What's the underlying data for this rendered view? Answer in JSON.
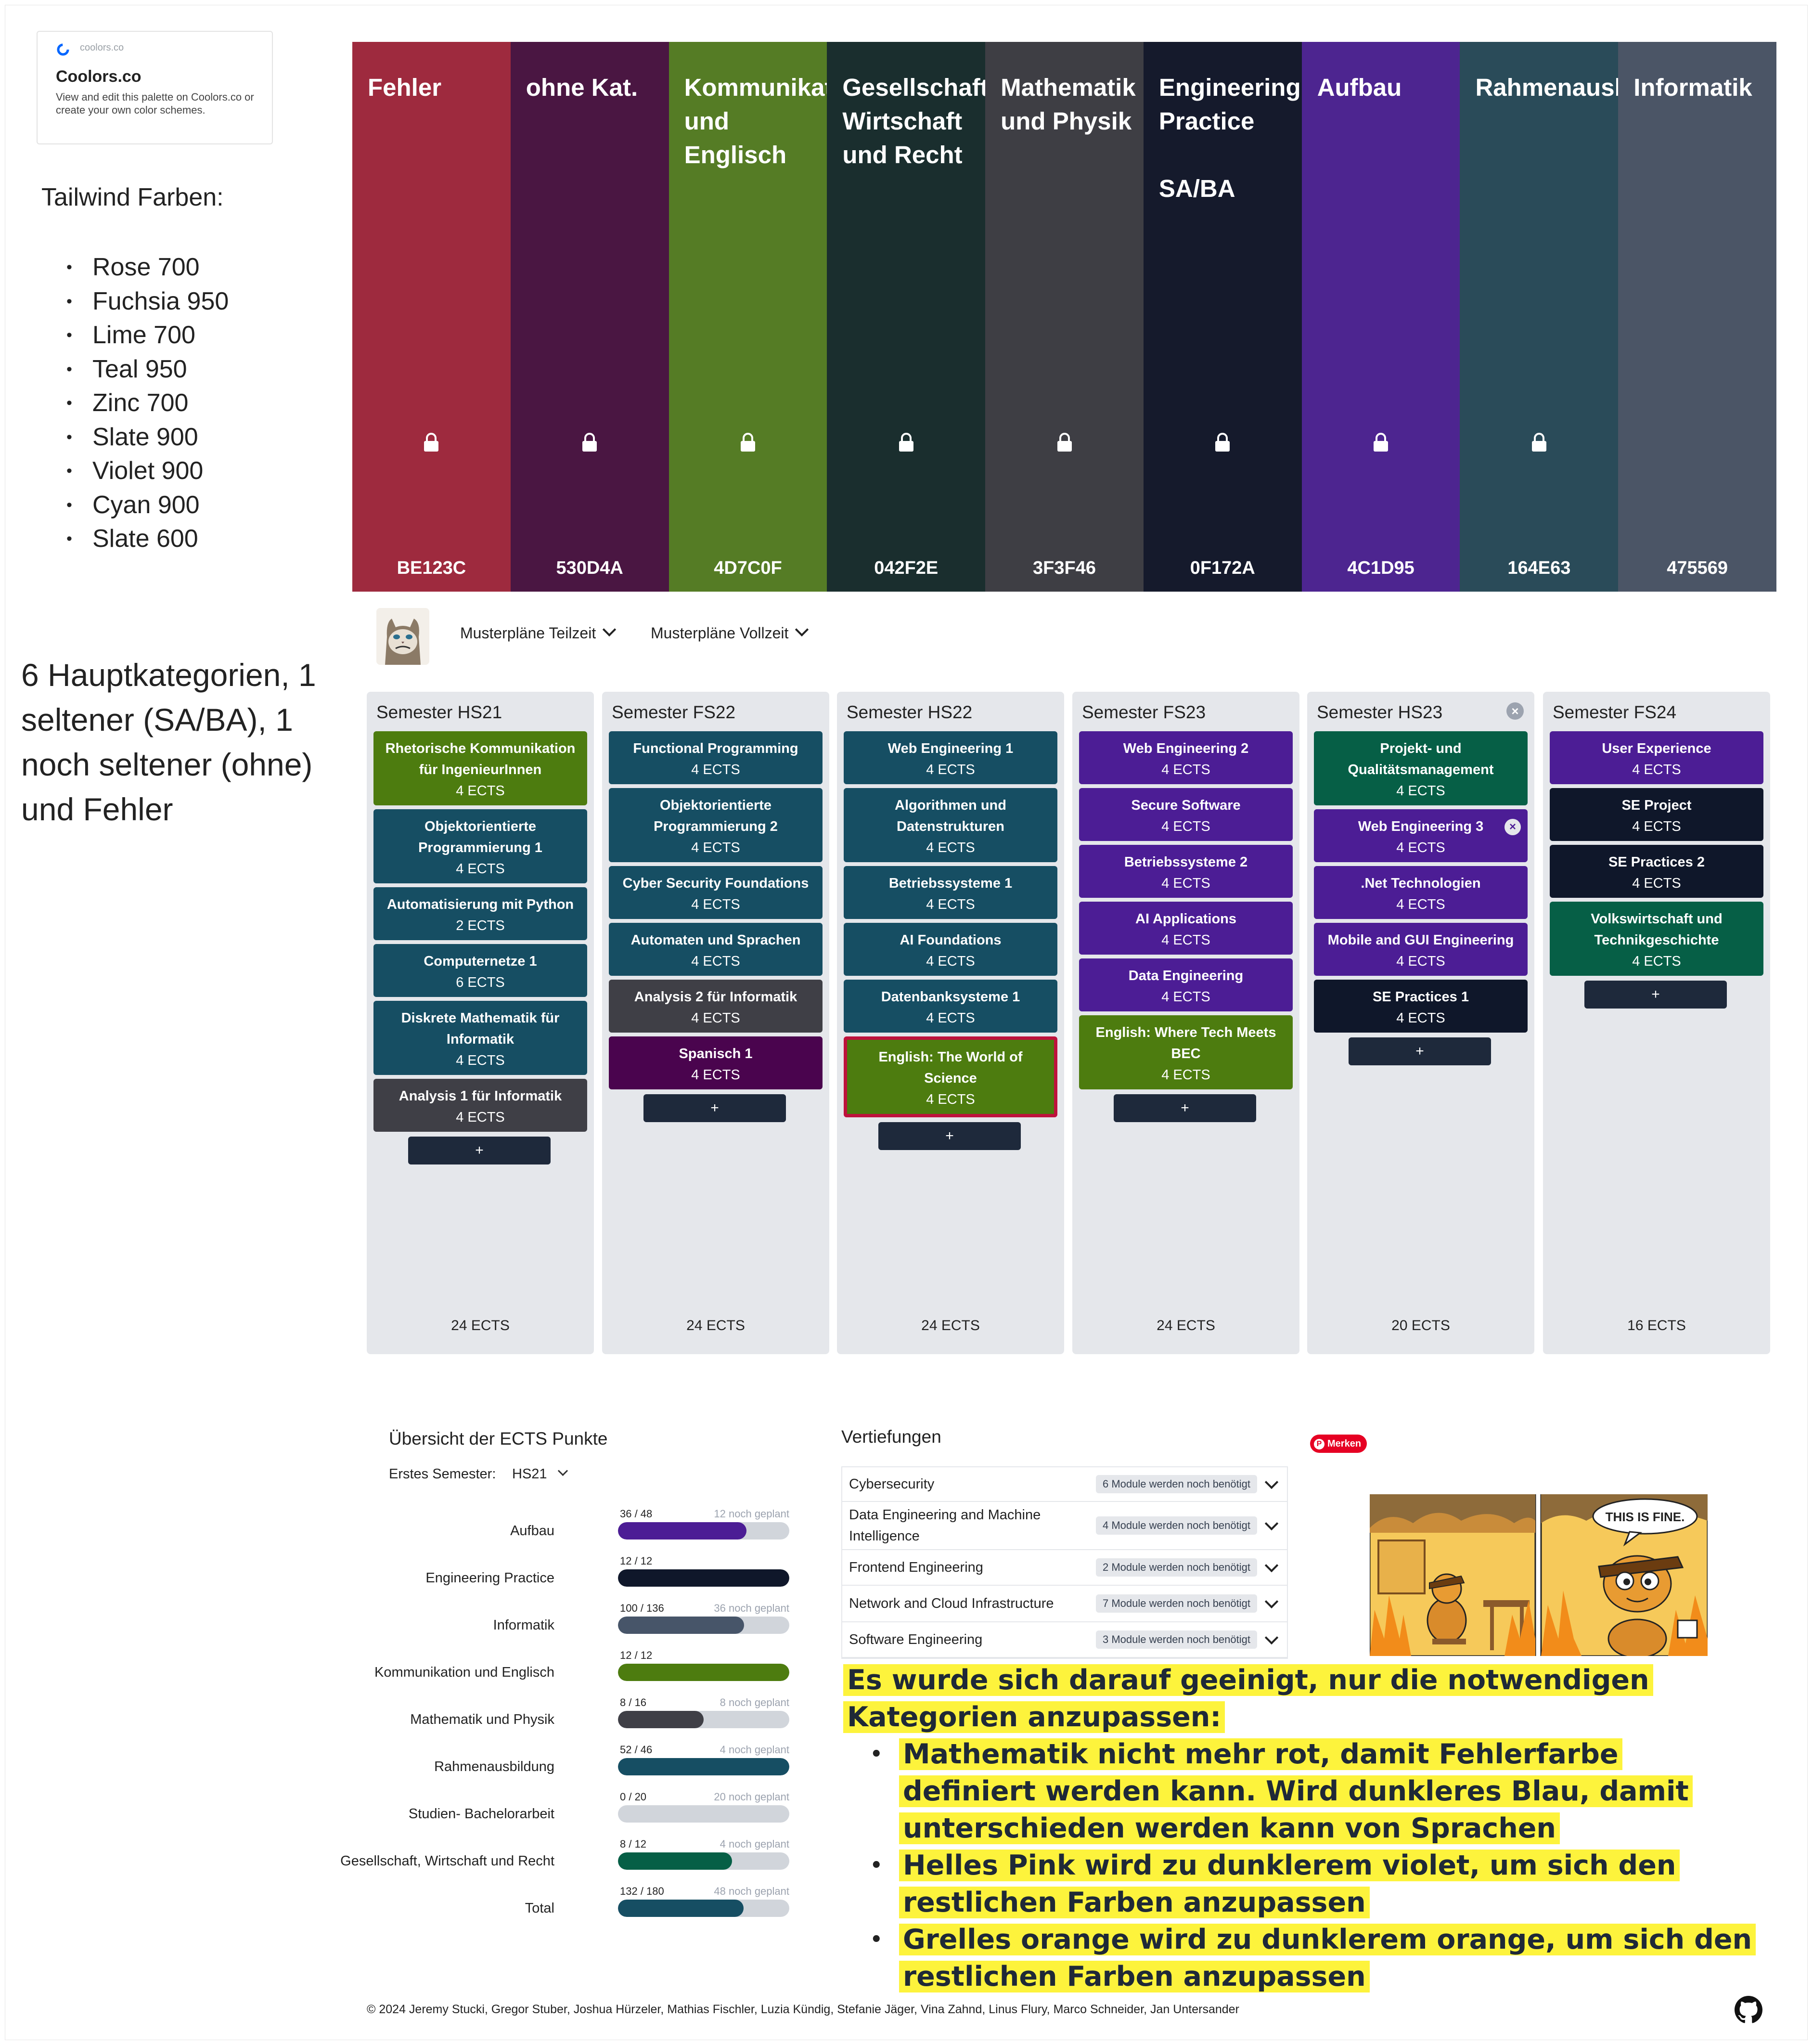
{
  "coolors_badge": {
    "small_label": "coolors.co",
    "title": "Coolors.co",
    "description": "View and edit this palette on Coolors.co or create your own color schemes."
  },
  "tailwind": {
    "title": "Tailwind Farben:",
    "items": [
      "Rose 700",
      "Fuchsia 950",
      "Lime 700",
      "Teal 950",
      "Zinc 700",
      "Slate 900",
      "Violet 900",
      "Cyan 900",
      "Slate 600"
    ]
  },
  "summary_text": "6 Hauptkategorien, 1 seltener (SA/BA), 1 noch seltener (ohne) und Fehler",
  "palette": [
    {
      "label": "Fehler",
      "hex": "BE123C",
      "color_name": "Red (NCS)",
      "bg": "#9e2a3e",
      "lock": true
    },
    {
      "label": "ohne Kat.",
      "hex": "530D4A",
      "color_name": "Palatinate",
      "bg": "#4a1642",
      "lock": true
    },
    {
      "label": "Kommunikation und Englisch",
      "hex": "4D7C0F",
      "color_name": "Avocado",
      "bg": "#557c25",
      "lock": true
    },
    {
      "label": "Gesellschaft, Wirtschaft und Recht",
      "hex": "042F2E",
      "color_name": "Dark green",
      "bg": "#1a2e2e",
      "lock": true
    },
    {
      "label": "Mathematik und Physik",
      "hex": "3F3F46",
      "color_name": "Onyx",
      "bg": "#3e3e44",
      "lock": true
    },
    {
      "label": "Engineering Practice\n\nSA/BA",
      "hex": "0F172A",
      "color_name": "Oxford Blue",
      "bg": "#151a2c",
      "lock": true
    },
    {
      "label": "Aufbau",
      "hex": "4C1D95",
      "color_name": "Tekhelet",
      "bg": "#4d2590",
      "lock": true
    },
    {
      "label": "Rahmenausbildung",
      "hex": "164E63",
      "color_name": "Midnight green",
      "bg": "#2a4b59",
      "lock": true
    },
    {
      "label": "Informatik",
      "hex": "475569",
      "color_name": "Payne's gray",
      "bg": "#4b5566",
      "lock": false
    }
  ],
  "nav": {
    "menu1": "Musterpläne Teilzeit",
    "menu2": "Musterpläne Vollzeit"
  },
  "colors": {
    "kommunikation": "#4d7c0f",
    "rahmen": "#164e63",
    "mathe": "#3f3f46",
    "ohne": "#4a044e",
    "aufbau": "#4c1d95",
    "informatik": "#475569",
    "engineering": "#0f172a",
    "gesellschaft": "#065f46",
    "studien": "#9ca3af",
    "error_border": "#be123c"
  },
  "semesters": [
    {
      "title": "Semester HS21",
      "total": "24 ECTS",
      "closable": false,
      "add_label": "+",
      "modules": [
        {
          "name": "Rhetorische Kommunikation für IngenieurInnen",
          "ects": "4 ECTS",
          "cat": "kommunikation"
        },
        {
          "name": "Objektorientierte Programmierung 1",
          "ects": "4 ECTS",
          "cat": "rahmen"
        },
        {
          "name": "Automatisierung mit Python",
          "ects": "2 ECTS",
          "cat": "rahmen"
        },
        {
          "name": "Computernetze 1",
          "ects": "6 ECTS",
          "cat": "rahmen"
        },
        {
          "name": "Diskrete Mathematik für Informatik",
          "ects": "4 ECTS",
          "cat": "rahmen"
        },
        {
          "name": "Analysis 1 für Informatik",
          "ects": "4 ECTS",
          "cat": "mathe"
        }
      ]
    },
    {
      "title": "Semester FS22",
      "total": "24 ECTS",
      "closable": false,
      "add_label": "+",
      "modules": [
        {
          "name": "Functional Programming",
          "ects": "4 ECTS",
          "cat": "rahmen"
        },
        {
          "name": "Objektorientierte Programmierung 2",
          "ects": "4 ECTS",
          "cat": "rahmen"
        },
        {
          "name": "Cyber Security Foundations",
          "ects": "4 ECTS",
          "cat": "rahmen"
        },
        {
          "name": "Automaten und Sprachen",
          "ects": "4 ECTS",
          "cat": "rahmen"
        },
        {
          "name": "Analysis 2 für Informatik",
          "ects": "4 ECTS",
          "cat": "mathe"
        },
        {
          "name": "Spanisch 1",
          "ects": "4 ECTS",
          "cat": "ohne"
        }
      ]
    },
    {
      "title": "Semester HS22",
      "total": "24 ECTS",
      "closable": false,
      "add_label": "+",
      "modules": [
        {
          "name": "Web Engineering 1",
          "ects": "4 ECTS",
          "cat": "rahmen"
        },
        {
          "name": "Algorithmen und Datenstrukturen",
          "ects": "4 ECTS",
          "cat": "rahmen"
        },
        {
          "name": "Betriebssysteme 1",
          "ects": "4 ECTS",
          "cat": "rahmen"
        },
        {
          "name": "AI Foundations",
          "ects": "4 ECTS",
          "cat": "rahmen"
        },
        {
          "name": "Datenbanksysteme 1",
          "ects": "4 ECTS",
          "cat": "rahmen"
        },
        {
          "name": "English: The World of Science",
          "ects": "4 ECTS",
          "cat": "kommunikation",
          "error": true
        }
      ]
    },
    {
      "title": "Semester FS23",
      "total": "24 ECTS",
      "closable": false,
      "add_label": "+",
      "modules": [
        {
          "name": "Web Engineering 2",
          "ects": "4 ECTS",
          "cat": "aufbau"
        },
        {
          "name": "Secure Software",
          "ects": "4 ECTS",
          "cat": "aufbau"
        },
        {
          "name": "Betriebssysteme 2",
          "ects": "4 ECTS",
          "cat": "aufbau"
        },
        {
          "name": "AI Applications",
          "ects": "4 ECTS",
          "cat": "aufbau"
        },
        {
          "name": "Data Engineering",
          "ects": "4 ECTS",
          "cat": "aufbau"
        },
        {
          "name": "English: Where Tech Meets BEC",
          "ects": "4 ECTS",
          "cat": "kommunikation"
        }
      ]
    },
    {
      "title": "Semester HS23",
      "total": "20 ECTS",
      "closable": true,
      "add_label": "+",
      "modules": [
        {
          "name": "Projekt- und Qualitätsmanagement",
          "ects": "4 ECTS",
          "cat": "gesellschaft"
        },
        {
          "name": "Web Engineering 3",
          "ects": "4 ECTS",
          "cat": "aufbau",
          "removable": true
        },
        {
          "name": ".Net Technologien",
          "ects": "4 ECTS",
          "cat": "aufbau"
        },
        {
          "name": "Mobile and GUI Engineering",
          "ects": "4 ECTS",
          "cat": "aufbau"
        },
        {
          "name": "SE Practices 1",
          "ects": "4 ECTS",
          "cat": "engineering"
        }
      ]
    },
    {
      "title": "Semester FS24",
      "total": "16 ECTS",
      "closable": false,
      "add_label": "+",
      "modules": [
        {
          "name": "User Experience",
          "ects": "4 ECTS",
          "cat": "aufbau"
        },
        {
          "name": "SE Project",
          "ects": "4 ECTS",
          "cat": "engineering"
        },
        {
          "name": "SE Practices 2",
          "ects": "4 ECTS",
          "cat": "engineering"
        },
        {
          "name": "Volkswirtschaft und Technikgeschichte",
          "ects": "4 ECTS",
          "cat": "gesellschaft"
        }
      ]
    }
  ],
  "overview": {
    "title": "Übersicht der ECTS Punkte",
    "first_semester_label": "Erstes Semester:",
    "first_semester_value": "HS21",
    "rows": [
      {
        "label": "Aufbau",
        "value": "36 / 48",
        "planned": "12 noch geplant",
        "fraction": 0.75,
        "cat": "aufbau"
      },
      {
        "label": "Engineering Practice",
        "value": "12 / 12",
        "planned": "",
        "fraction": 1.0,
        "cat": "engineering"
      },
      {
        "label": "Informatik",
        "value": "100 / 136",
        "planned": "36 noch geplant",
        "fraction": 0.735,
        "cat": "informatik"
      },
      {
        "label": "Kommunikation und Englisch",
        "value": "12 / 12",
        "planned": "",
        "fraction": 1.0,
        "cat": "kommunikation"
      },
      {
        "label": "Mathematik und Physik",
        "value": "8 / 16",
        "planned": "8 noch geplant",
        "fraction": 0.5,
        "cat": "mathe"
      },
      {
        "label": "Rahmenausbildung",
        "value": "52 / 46",
        "planned": "4 noch geplant",
        "fraction": 1.0,
        "cat": "rahmen"
      },
      {
        "label": "Studien- Bachelorarbeit",
        "value": "0 / 20",
        "planned": "20 noch geplant",
        "fraction": 0.0,
        "cat": "studien"
      },
      {
        "label": "Gesellschaft, Wirtschaft und Recht",
        "value": "8 / 12",
        "planned": "4 noch geplant",
        "fraction": 0.667,
        "cat": "gesellschaft"
      },
      {
        "label": "Total",
        "value": "132 / 180",
        "planned": "48 noch geplant",
        "fraction": 0.733,
        "cat": "rahmen"
      }
    ]
  },
  "vertiefungen": {
    "title": "Vertiefungen",
    "rows": [
      {
        "name": "Cybersecurity",
        "badge": "6 Module werden noch benötigt"
      },
      {
        "name": "Data Engineering and Machine Intelligence",
        "badge": "4 Module werden noch benötigt"
      },
      {
        "name": "Frontend Engineering",
        "badge": "2 Module werden noch benötigt"
      },
      {
        "name": "Network and Cloud Infrastructure",
        "badge": "7 Module werden noch benötigt"
      },
      {
        "name": "Software Engineering",
        "badge": "3 Module werden noch benötigt"
      }
    ]
  },
  "pin_button": "Merken",
  "meme_caption": "THIS IS FINE.",
  "notes": {
    "intro": "Es wurde sich darauf geeinigt, nur die notwendigen Kategorien anzupassen:",
    "items": [
      "Mathematik nicht mehr rot, damit Fehlerfarbe definiert werden kann. Wird dunkleres Blau, damit unterschieden werden kann von Sprachen",
      "Helles Pink wird zu dunklerem violet, um sich den restlichen Farben anzupassen",
      "Grelles orange wird zu dunklerem orange, um sich den restlichen Farben anzupassen"
    ]
  },
  "footer": "© 2024 Jeremy Stucki, Gregor Stuber, Joshua Hürzeler, Mathias Fischler, Luzia Kündig, Stefanie Jäger, Vina Zahnd, Linus Flury, Marco Schneider, Jan Untersander"
}
